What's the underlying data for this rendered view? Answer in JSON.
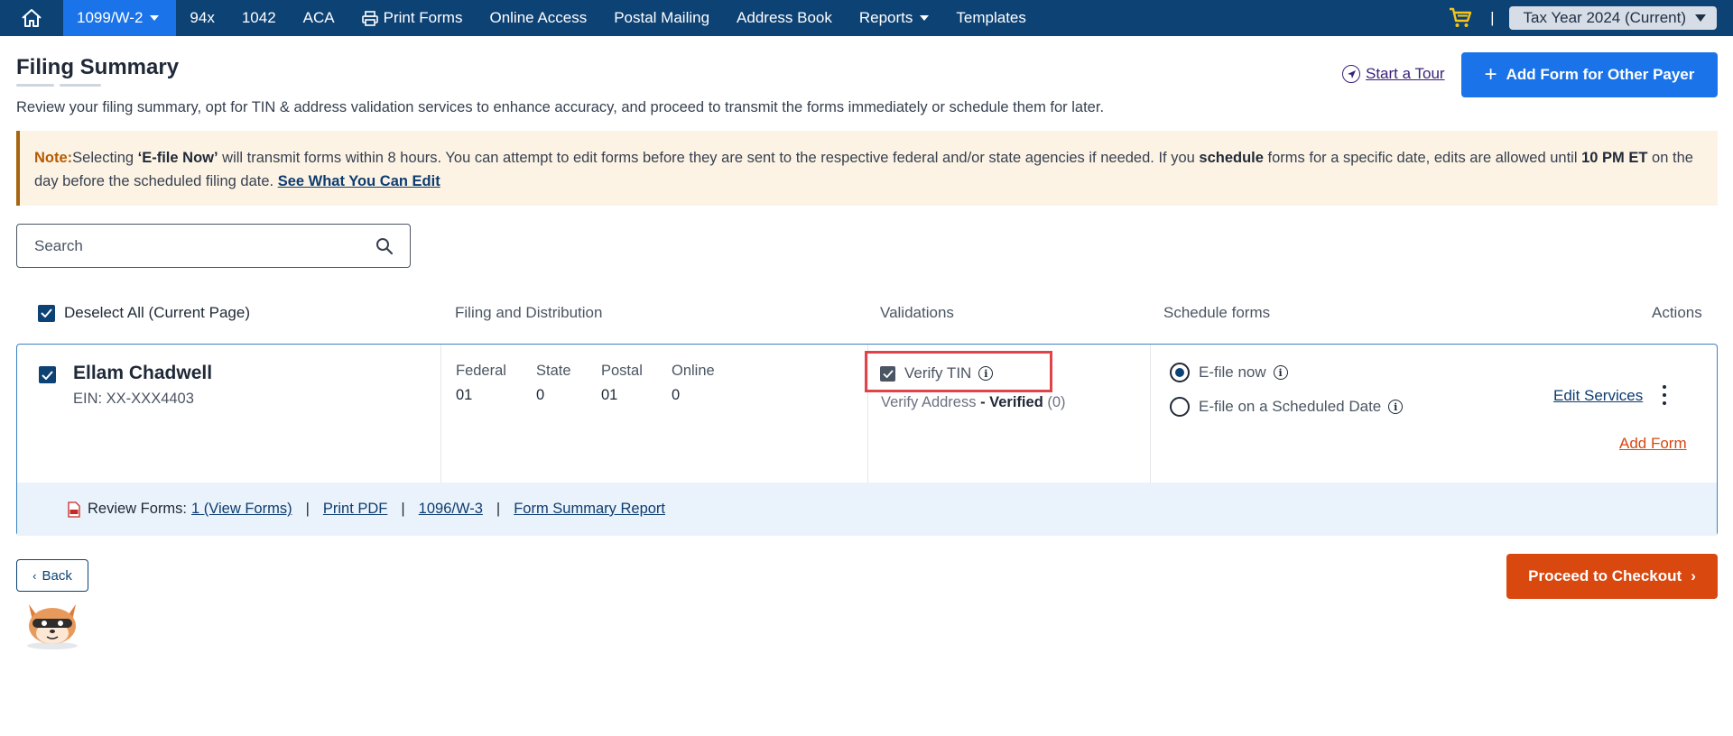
{
  "nav": {
    "items": [
      {
        "label": "1099/W-2",
        "dropdown": true,
        "active": true
      },
      {
        "label": "94x"
      },
      {
        "label": "1042"
      },
      {
        "label": "ACA"
      },
      {
        "label": "Print Forms",
        "icon": "printer-icon"
      },
      {
        "label": "Online Access"
      },
      {
        "label": "Postal Mailing"
      },
      {
        "label": "Address Book"
      },
      {
        "label": "Reports",
        "dropdown": true
      },
      {
        "label": "Templates"
      }
    ],
    "separator": "|",
    "tax_year": "Tax Year 2024 (Current)"
  },
  "header": {
    "title": "Filing Summary",
    "subtitle": "Review your filing summary, opt for TIN & address validation services to enhance accuracy, and proceed to transmit the forms immediately or schedule them for later.",
    "tour_label": "Start a Tour",
    "add_payer_label": "Add Form for Other Payer"
  },
  "note": {
    "label": "Note:",
    "t1": "Selecting ",
    "b1": "‘E-file Now’",
    "t2": " will transmit forms within 8 hours. You can attempt to edit forms before they are sent to the respective federal and/or state agencies if needed. If you ",
    "b2": "schedule",
    "t3": " forms for a specific date, edits are allowed until ",
    "b3": "10 PM ET",
    "t4": " on the day before the scheduled filing date. ",
    "link": "See What You Can Edit"
  },
  "search": {
    "placeholder": "Search"
  },
  "columns": {
    "deselect": "Deselect All (Current Page)",
    "filing": "Filing and Distribution",
    "validations": "Validations",
    "schedule": "Schedule forms",
    "actions": "Actions"
  },
  "payer": {
    "name": "Ellam Chadwell",
    "ein": "EIN: XX-XXX4403",
    "counts": [
      {
        "label": "Federal",
        "value": "01"
      },
      {
        "label": "State",
        "value": "0"
      },
      {
        "label": "Postal",
        "value": "01"
      },
      {
        "label": "Online",
        "value": "0"
      }
    ],
    "verify_tin": "Verify TIN",
    "verify_address": "Verify Address",
    "verify_dash": " - ",
    "verified": "Verified",
    "verify_count": " (0)",
    "efile_now": "E-file now",
    "efile_scheduled": "E-file on a Scheduled Date",
    "edit_services": "Edit Services",
    "add_form": "Add Form",
    "review_label": "Review Forms:",
    "view_forms": "1 (View Forms)",
    "print_pdf": "Print PDF",
    "w3": "1096/W-3",
    "summary_report": "Form Summary Report",
    "pipe": "|"
  },
  "footer": {
    "back": "Back",
    "checkout": "Proceed to Checkout"
  },
  "colors": {
    "nav_bg": "#0d4275",
    "accent_blue": "#1a73e8",
    "accent_orange": "#d9480f",
    "highlight_red": "#e0444a"
  }
}
